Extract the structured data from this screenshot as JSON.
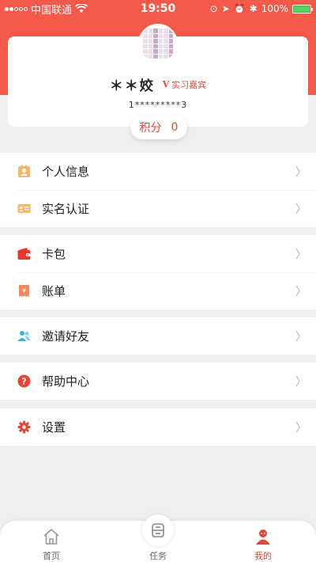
{
  "status_bar": {
    "carrier": "中国联通",
    "time": "19:50",
    "battery": "100%"
  },
  "profile": {
    "username": "＊＊姣",
    "vip_mark": "V",
    "vip_label": "实习嘉宾",
    "phone": "1*********3",
    "points_label": "积分",
    "points_value": "0"
  },
  "menu": {
    "personal_info": "个人信息",
    "real_name": "实名认证",
    "card_wallet": "卡包",
    "bill": "账单",
    "invite": "邀请好友",
    "help": "帮助中心",
    "settings": "设置"
  },
  "colors": {
    "brand": "#f5594a",
    "accent": "#e04a3a"
  },
  "bottom_nav": {
    "home": "首页",
    "task": "任务",
    "mine": "我的"
  }
}
